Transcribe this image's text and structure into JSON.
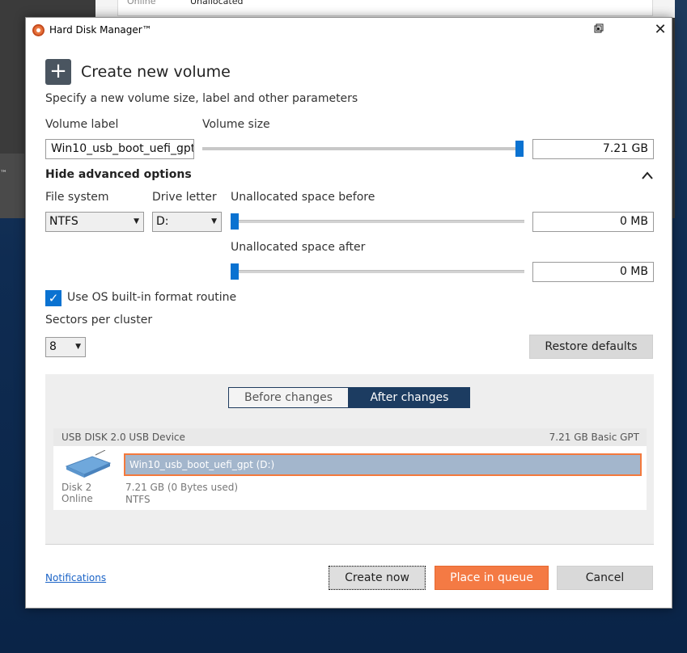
{
  "background": {
    "status_online": "Online",
    "status_unallocated": "Unallocated",
    "fragment_tm": "™"
  },
  "window": {
    "title": "Hard Disk Manager™",
    "restore_icon": "restore-icon",
    "close_glyph": "✕"
  },
  "header": {
    "title": "Create new volume",
    "subtitle": "Specify a new volume size, label and other parameters"
  },
  "volume": {
    "label_caption": "Volume label",
    "label_value": "Win10_usb_boot_uefi_gpt",
    "size_caption": "Volume size",
    "size_value": "7.21 GB",
    "size_slider_fraction": 1.0
  },
  "advanced": {
    "toggle_label": "Hide advanced options",
    "file_system_caption": "File system",
    "file_system_value": "NTFS",
    "drive_letter_caption": "Drive letter",
    "drive_letter_value": "D:",
    "unalloc_before_caption": "Unallocated space before",
    "unalloc_before_value": "0 MB",
    "unalloc_before_fraction": 0.0,
    "unalloc_after_caption": "Unallocated space after",
    "unalloc_after_value": "0 MB",
    "unalloc_after_fraction": 0.0,
    "use_os_format_label": "Use OS built-in format routine",
    "use_os_format_checked": true,
    "sectors_caption": "Sectors per cluster",
    "sectors_value": "8",
    "restore_defaults_label": "Restore defaults"
  },
  "preview": {
    "tabs": [
      {
        "label": "Before changes",
        "active": false
      },
      {
        "label": "After changes",
        "active": true
      }
    ],
    "disk": {
      "device": "USB DISK 2.0 USB Device",
      "info": "7.21 GB Basic GPT",
      "number": "Disk 2",
      "status": "Online",
      "partition_label": "Win10_usb_boot_uefi_gpt (D:)",
      "partition_size": "7.21 GB (0 Bytes used)",
      "partition_fs": "NTFS"
    }
  },
  "footer": {
    "notifications_link": "Notifications",
    "create_now": "Create now",
    "place_in_queue": "Place in queue",
    "cancel": "Cancel"
  },
  "colors": {
    "accent_blue": "#0a72d1",
    "tab_active": "#1c3c61",
    "orange": "#f47a44",
    "partition_fill": "#a3b6cc"
  }
}
